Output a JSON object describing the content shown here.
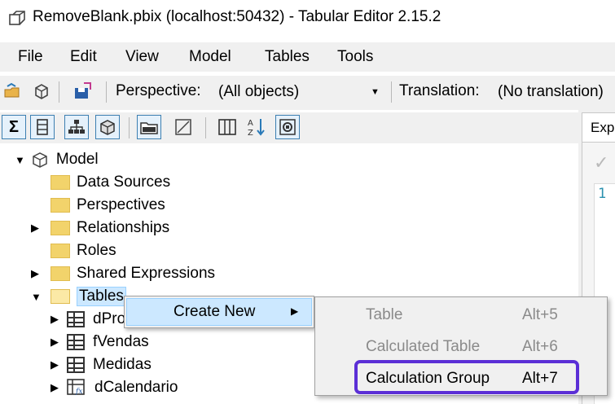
{
  "window": {
    "title": "RemoveBlank.pbix (localhost:50432) - Tabular Editor 2.15.2"
  },
  "menu": {
    "items": [
      "File",
      "Edit",
      "View",
      "Model",
      "Tables",
      "Tools"
    ]
  },
  "toolbar": {
    "perspective_label": "Perspective:",
    "perspective_value": "(All objects)",
    "translation_label": "Translation:",
    "translation_value": "(No translation)"
  },
  "right_panel": {
    "tab_label": "Exp",
    "line_number": "1"
  },
  "tree": {
    "model": "Model",
    "folders": [
      "Data Sources",
      "Perspectives",
      "Relationships",
      "Roles",
      "Shared Expressions",
      "Tables"
    ],
    "tables": [
      "dPro",
      "fVendas",
      "Medidas",
      "dCalendario"
    ]
  },
  "context_menu": {
    "create_new": "Create New",
    "submenu": [
      {
        "label": "Table",
        "shortcut": "Alt+5"
      },
      {
        "label": "Calculated Table",
        "shortcut": "Alt+6"
      },
      {
        "label": "Calculation Group",
        "shortcut": "Alt+7"
      }
    ]
  },
  "colors": {
    "highlight_outline": "#5b2fd6",
    "selection": "#cce8ff"
  }
}
